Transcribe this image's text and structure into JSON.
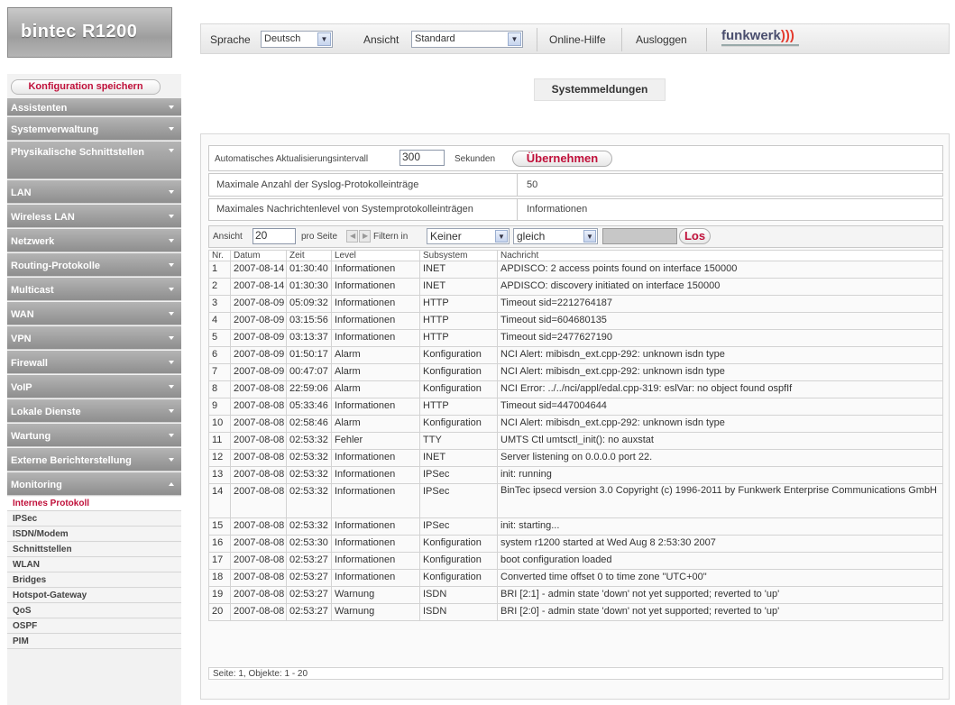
{
  "header": {
    "brand": "bintec R1200",
    "language_label": "Sprache",
    "language_value": "Deutsch",
    "view_label": "Ansicht",
    "view_value": "Standard",
    "help_label": "Online-Hilfe",
    "logout_label": "Ausloggen",
    "logo_text": "funkwerk"
  },
  "sidebar": {
    "save_label": "Konfiguration speichern",
    "items": [
      {
        "label": "Assistenten"
      },
      {
        "label": "Systemverwaltung"
      },
      {
        "label": "Physikalische Schnittstellen"
      },
      {
        "label": "LAN"
      },
      {
        "label": "Wireless LAN"
      },
      {
        "label": "Netzwerk"
      },
      {
        "label": "Routing-Protokolle"
      },
      {
        "label": "Multicast"
      },
      {
        "label": "WAN"
      },
      {
        "label": "VPN"
      },
      {
        "label": "Firewall"
      },
      {
        "label": "VoIP"
      },
      {
        "label": "Lokale Dienste"
      },
      {
        "label": "Wartung"
      },
      {
        "label": "Externe Berichterstellung"
      },
      {
        "label": "Monitoring"
      }
    ],
    "subitems": [
      {
        "label": "Internes Protokoll"
      },
      {
        "label": "IPSec"
      },
      {
        "label": "ISDN/Modem"
      },
      {
        "label": "Schnittstellen"
      },
      {
        "label": "WLAN"
      },
      {
        "label": "Bridges"
      },
      {
        "label": "Hotspot-Gateway"
      },
      {
        "label": "QoS"
      },
      {
        "label": "OSPF"
      },
      {
        "label": "PIM"
      }
    ]
  },
  "main": {
    "title": "Systemmeldungen",
    "refresh_label": "Automatisches Aktualisierungsintervall",
    "refresh_value": "300",
    "refresh_unit": "Sekunden",
    "apply_label": "Übernehmen",
    "max_syslog_label": "Maximale Anzahl der Syslog-Protokolleinträge",
    "max_syslog_value": "50",
    "max_level_label": "Maximales Nachrichtenlevel von Systemprotokolleinträgen",
    "max_level_value": "Informationen",
    "filter": {
      "view_label": "Ansicht",
      "view_value": "20",
      "per_page_label": "pro Seite",
      "filter_in_label": "Filtern in",
      "filter_in_value": "Keiner",
      "op_value": "gleich",
      "go_label": "Los"
    },
    "columns": [
      "Nr.",
      "Datum",
      "Zeit",
      "Level",
      "Subsystem",
      "Nachricht"
    ],
    "rows": [
      {
        "nr": "1",
        "date": "2007-08-14",
        "time": "01:30:40",
        "level": "Informationen",
        "sub": "INET",
        "msg": "APDISCO: 2 access points found on interface 150000"
      },
      {
        "nr": "2",
        "date": "2007-08-14",
        "time": "01:30:30",
        "level": "Informationen",
        "sub": "INET",
        "msg": "APDISCO: discovery initiated on interface 150000"
      },
      {
        "nr": "3",
        "date": "2007-08-09",
        "time": "05:09:32",
        "level": "Informationen",
        "sub": "HTTP",
        "msg": "Timeout sid=2212764187"
      },
      {
        "nr": "4",
        "date": "2007-08-09",
        "time": "03:15:56",
        "level": "Informationen",
        "sub": "HTTP",
        "msg": "Timeout sid=604680135"
      },
      {
        "nr": "5",
        "date": "2007-08-09",
        "time": "03:13:37",
        "level": "Informationen",
        "sub": "HTTP",
        "msg": "Timeout sid=2477627190"
      },
      {
        "nr": "6",
        "date": "2007-08-09",
        "time": "01:50:17",
        "level": "Alarm",
        "sub": "Konfiguration",
        "msg": "NCI Alert: mibisdn_ext.cpp-292: unknown isdn type"
      },
      {
        "nr": "7",
        "date": "2007-08-09",
        "time": "00:47:07",
        "level": "Alarm",
        "sub": "Konfiguration",
        "msg": "NCI Alert: mibisdn_ext.cpp-292: unknown isdn type"
      },
      {
        "nr": "8",
        "date": "2007-08-08",
        "time": "22:59:06",
        "level": "Alarm",
        "sub": "Konfiguration",
        "msg": "NCI Error: ../../nci/appl/edal.cpp-319: eslVar: no object found ospfIf"
      },
      {
        "nr": "9",
        "date": "2007-08-08",
        "time": "05:33:46",
        "level": "Informationen",
        "sub": "HTTP",
        "msg": "Timeout sid=447004644"
      },
      {
        "nr": "10",
        "date": "2007-08-08",
        "time": "02:58:46",
        "level": "Alarm",
        "sub": "Konfiguration",
        "msg": "NCI Alert: mibisdn_ext.cpp-292: unknown isdn type"
      },
      {
        "nr": "11",
        "date": "2007-08-08",
        "time": "02:53:32",
        "level": "Fehler",
        "sub": "TTY",
        "msg": "UMTS Ctl umtsctl_init(): no auxstat"
      },
      {
        "nr": "12",
        "date": "2007-08-08",
        "time": "02:53:32",
        "level": "Informationen",
        "sub": "INET",
        "msg": "Server listening on 0.0.0.0 port 22."
      },
      {
        "nr": "13",
        "date": "2007-08-08",
        "time": "02:53:32",
        "level": "Informationen",
        "sub": "IPSec",
        "msg": "init: running"
      },
      {
        "nr": "14",
        "date": "2007-08-08",
        "time": "02:53:32",
        "level": "Informationen",
        "sub": "IPSec",
        "msg": "BinTec ipsecd version 3.0 Copyright (c) 1996-2011 by Funkwerk Enterprise Communications GmbH"
      },
      {
        "nr": "15",
        "date": "2007-08-08",
        "time": "02:53:32",
        "level": "Informationen",
        "sub": "IPSec",
        "msg": "init: starting..."
      },
      {
        "nr": "16",
        "date": "2007-08-08",
        "time": "02:53:30",
        "level": "Informationen",
        "sub": "Konfiguration",
        "msg": "system r1200 started at Wed Aug 8 2:53:30 2007"
      },
      {
        "nr": "17",
        "date": "2007-08-08",
        "time": "02:53:27",
        "level": "Informationen",
        "sub": "Konfiguration",
        "msg": "boot configuration loaded"
      },
      {
        "nr": "18",
        "date": "2007-08-08",
        "time": "02:53:27",
        "level": "Informationen",
        "sub": "Konfiguration",
        "msg": "Converted time offset 0 to time zone \"UTC+00\""
      },
      {
        "nr": "19",
        "date": "2007-08-08",
        "time": "02:53:27",
        "level": "Warnung",
        "sub": "ISDN",
        "msg": "BRI [2:1] - admin state 'down' not yet supported; reverted to 'up'"
      },
      {
        "nr": "20",
        "date": "2007-08-08",
        "time": "02:53:27",
        "level": "Warnung",
        "sub": "ISDN",
        "msg": "BRI [2:0] - admin state 'down' not yet supported; reverted to 'up'"
      }
    ],
    "footer": "Seite: 1, Objekte: 1 - 20"
  }
}
